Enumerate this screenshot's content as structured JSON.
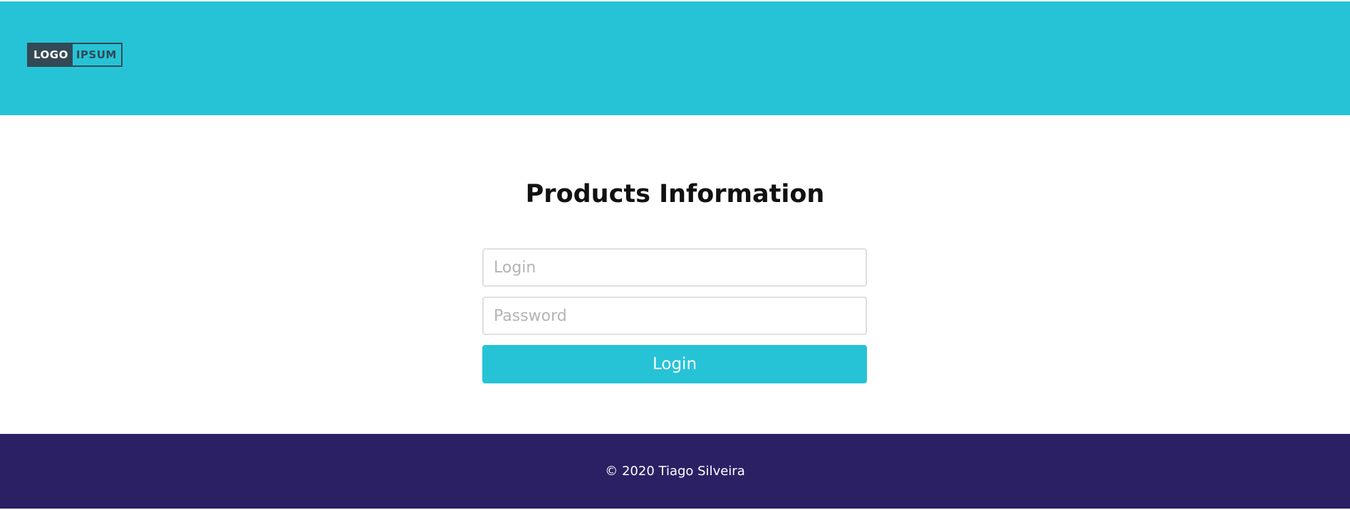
{
  "header": {
    "logo": {
      "left_text": "LOGO",
      "right_text": "IPSUM"
    },
    "background_color": "#26c3d7"
  },
  "main": {
    "title": "Products Information",
    "form": {
      "login_field": {
        "placeholder": "Login",
        "value": ""
      },
      "password_field": {
        "placeholder": "Password",
        "value": ""
      },
      "submit_label": "Login"
    },
    "accent_color": "#26c3d7"
  },
  "footer": {
    "text": "© 2020 Tiago Silveira",
    "background_color": "#2c2065"
  }
}
